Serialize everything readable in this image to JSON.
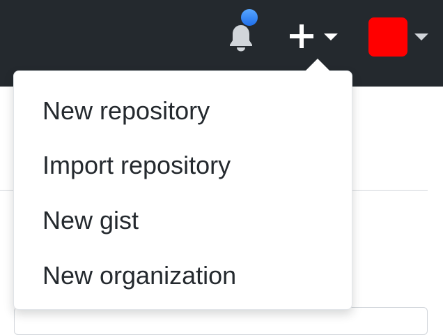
{
  "header": {
    "notifications": {
      "icon": "bell-icon",
      "unread_indicator_color": "#1f6feb"
    },
    "create": {
      "icon": "plus-icon",
      "caret_icon": "caret-down-icon"
    },
    "avatar": {
      "color": "#ff0000",
      "caret_icon": "caret-down-icon"
    },
    "background_color": "#24292e"
  },
  "dropdown": {
    "items": [
      {
        "label": "New repository"
      },
      {
        "label": "Import repository"
      },
      {
        "label": "New gist"
      },
      {
        "label": "New organization"
      }
    ]
  }
}
